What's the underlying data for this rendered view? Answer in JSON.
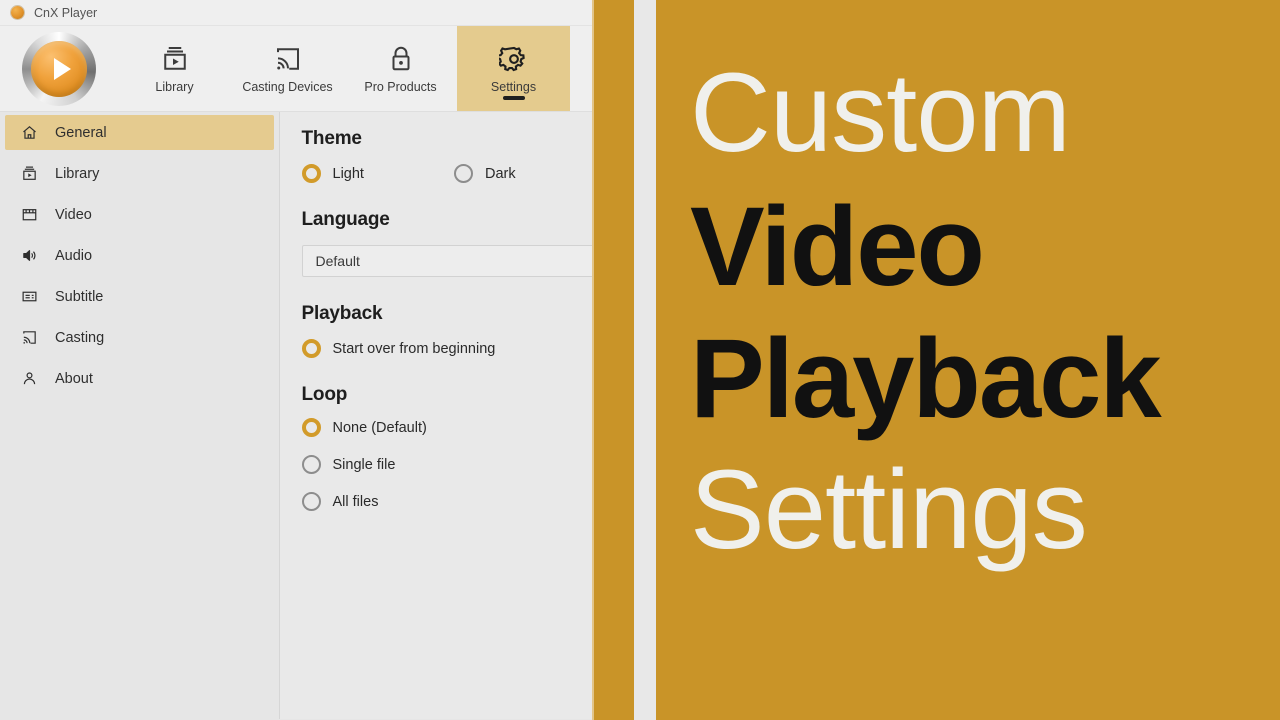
{
  "window": {
    "title": "CnX Player",
    "logo_icon": "cnx-player-orb-icon"
  },
  "theme_colors": {
    "accent_gold": "#C99428",
    "accent_tan": "#E5CB8F",
    "radio_selected": "#D29B2A",
    "panel_bg": "#E9E9E9",
    "sidebar_bg": "#E6E6E6",
    "promo_text_light": "#F0F0EC",
    "promo_text_bold": "#111111"
  },
  "ribbon": {
    "brand_logo_icon": "play-orb-logo-icon",
    "tabs": [
      {
        "label": "Library",
        "icon": "library-stack-icon",
        "active": false
      },
      {
        "label": "Casting Devices",
        "icon": "cast-screen-icon",
        "active": false
      },
      {
        "label": "Pro Products",
        "icon": "padlock-icon",
        "active": false
      },
      {
        "label": "Settings",
        "icon": "gear-icon",
        "active": true
      }
    ]
  },
  "sidebar": {
    "items": [
      {
        "label": "General",
        "icon": "home-icon",
        "selected": true
      },
      {
        "label": "Library",
        "icon": "library-box-icon",
        "selected": false
      },
      {
        "label": "Video",
        "icon": "clapperboard-icon",
        "selected": false
      },
      {
        "label": "Audio",
        "icon": "speaker-icon",
        "selected": false
      },
      {
        "label": "Subtitle",
        "icon": "subtitle-icon",
        "selected": false
      },
      {
        "label": "Casting",
        "icon": "cast-icon",
        "selected": false
      },
      {
        "label": "About",
        "icon": "person-icon",
        "selected": false
      }
    ]
  },
  "settings": {
    "theme": {
      "title": "Theme",
      "options": [
        {
          "label": "Light",
          "selected": true
        },
        {
          "label": "Dark",
          "selected": false
        }
      ]
    },
    "language": {
      "title": "Language",
      "selected_value": "Default",
      "chevron_icon": "chevron-down-icon"
    },
    "playback": {
      "title": "Playback",
      "options": [
        {
          "label": "Start over from beginning",
          "selected": true
        }
      ]
    },
    "loop": {
      "title": "Loop",
      "options": [
        {
          "label": "None (Default)",
          "selected": true
        },
        {
          "label": "Single file",
          "selected": false
        },
        {
          "label": "All files",
          "selected": false
        }
      ]
    }
  },
  "promo": {
    "lines": [
      {
        "text": "Custom",
        "style": "light"
      },
      {
        "text": "Video",
        "style": "bold"
      },
      {
        "text": "Playback",
        "style": "bold"
      },
      {
        "text": "Settings",
        "style": "light"
      }
    ]
  }
}
